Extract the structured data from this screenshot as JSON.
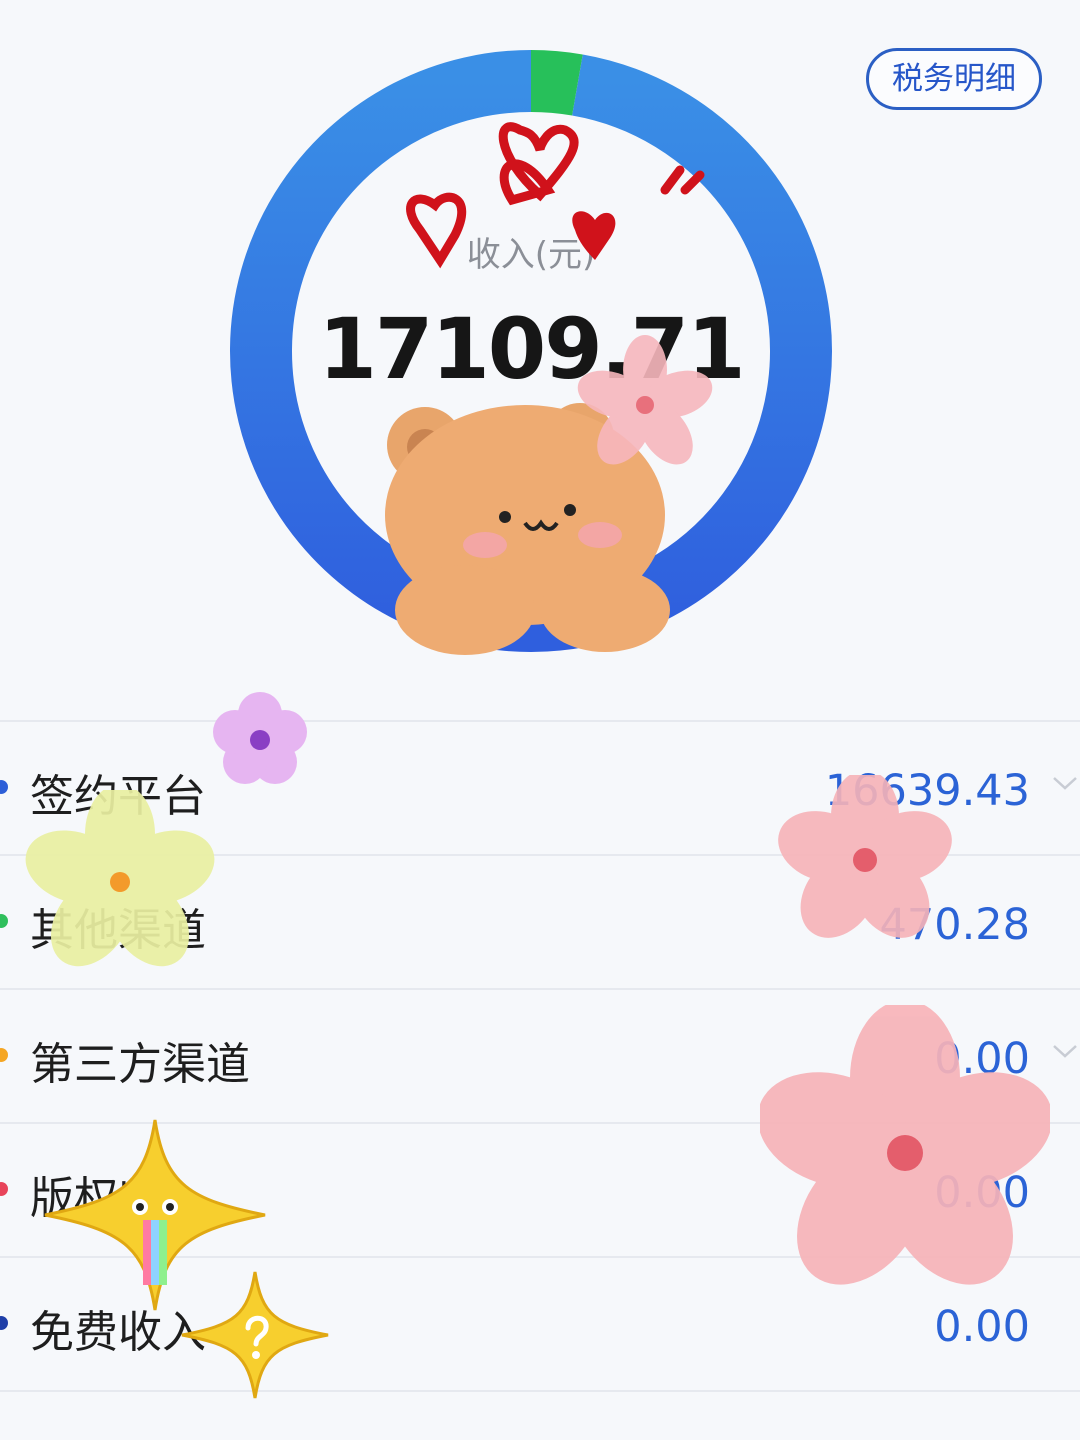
{
  "header": {
    "tax_detail_label": "税务明细"
  },
  "summary": {
    "total_label": "收入(元)",
    "total_value": "17109.71"
  },
  "colors": {
    "ring_blue_top": "#3a8fe6",
    "ring_blue_bottom": "#2f60de",
    "ring_green": "#27c05a",
    "value_blue": "#2b63d6"
  },
  "income_items": [
    {
      "label": "签约平台",
      "value": "16639.43",
      "amount": 16639.43,
      "dot_color": "#2d5fd8",
      "has_chevron": true
    },
    {
      "label": "其他渠道",
      "value": "470.28",
      "amount": 470.28,
      "dot_color": "#2fbf5c",
      "has_chevron": false
    },
    {
      "label": "第三方渠道",
      "value": "0.00",
      "amount": 0,
      "dot_color": "#f5a623",
      "has_chevron": true
    },
    {
      "label": "版权收入",
      "value": "0.00",
      "amount": 0,
      "dot_color": "#e8445a",
      "has_chevron": false
    },
    {
      "label": "免费收入",
      "value": "0.00",
      "amount": 0,
      "dot_color": "#1f3fa8",
      "has_chevron": false
    }
  ],
  "chart_data": {
    "type": "pie",
    "categories": [
      "签约平台",
      "其他渠道",
      "第三方渠道",
      "版权收入",
      "免费收入"
    ],
    "values": [
      16639.43,
      470.28,
      0.0,
      0.0,
      0.0
    ],
    "title": "收入(元)",
    "total": 17109.71
  }
}
